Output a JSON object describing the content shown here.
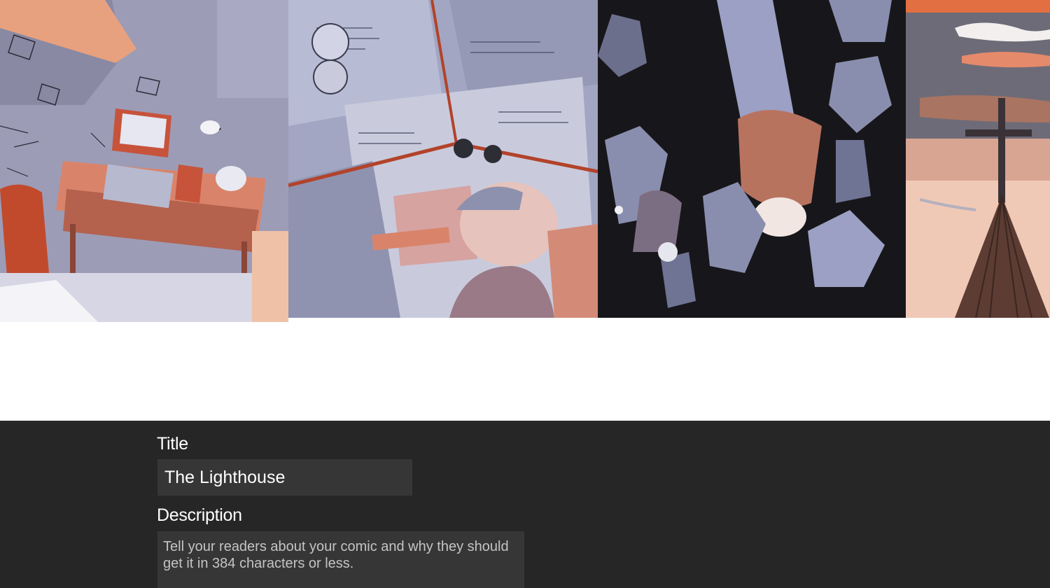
{
  "banner": {
    "panels": [
      {
        "name": "workshop-desk-panel"
      },
      {
        "name": "newspaper-clippings-panel"
      },
      {
        "name": "falling-figures-panel"
      },
      {
        "name": "church-spire-panel"
      }
    ]
  },
  "form": {
    "title_label": "Title",
    "title_value": "The Lighthouse",
    "description_label": "Description",
    "description_placeholder": "Tell your readers about your comic and why they should get it in 384 characters or less.",
    "description_value": ""
  },
  "colors": {
    "editor_background": "#262626",
    "input_background": "#363636",
    "label_text": "#ffffff",
    "placeholder_text": "#c4c4c4"
  }
}
